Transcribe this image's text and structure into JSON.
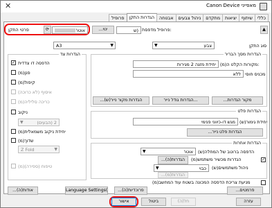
{
  "window": {
    "title": "Canon Device מאפייני",
    "close_glyph": "✕"
  },
  "tabs": [
    "כללי",
    "שיתוף",
    "יציאות",
    "מתקדם",
    "ניהול צבעים",
    "אבטחה",
    "הגדרות התקן",
    "פרופיל"
  ],
  "active_tab": "הגדרות התקן",
  "top": {
    "printer_profile_label": "פרופיל מדפסת:",
    "profile_value": "(ש",
    "change_button": "...ינוי",
    "device_info_label": "פרטי התקן",
    "device_info_value": "אוטו'",
    "device_name_blurred": "",
    "paper_source_label": "סוג התקן",
    "paper_source_value": "צבע",
    "paper_size_value": "A3"
  },
  "general_settings": {
    "legend": "הגדרות מסך הבריר",
    "input_label": "מקורות הקלט ה(מ):",
    "input_value": "יחידת מזגה 2 מגירות",
    "output_label": "מכניס חוסי",
    "output_value": "ללא",
    "btn_paper_source": "...מקור הגדרות",
    "btn_tray": "הגדרות גודל נייר...",
    "btn_settings": "...(ש)הגדרות מקור נייר"
  },
  "paper_settings": {
    "legend": "הגדרות פלט",
    "output_unit_label": "יחידת גימור(ש)",
    "output_unit_value": "מגש דו-כיווני פנימי",
    "btn_output": "...הגדרות פלט נייר"
  },
  "other_settings": {
    "legend": "הגדרות אחרות",
    "auto_label": "(ש)הדפסה ברוטב של המחלה",
    "auto_value": "אוטו'",
    "user_settings_label": "(מ)הגדרות מכשיר משתמש",
    "btn_user": "...(ה)הגדרות",
    "management_label": "(ש)ניהול משתמשים",
    "management_value": "כבוי",
    "btn_management": "...(מ)הגדרות",
    "duplex_label": "(מ)מניעת צריכת הדפסה המכונה בשטח עוד המחשב"
  },
  "options": {
    "legend": "הגדרות צד",
    "items": [
      {
        "label": "הדפסה דו צדדית",
        "checked": true,
        "disabled": false
      },
      {
        "label": "(מ)פנן",
        "checked": false,
        "disabled": false
      },
      {
        "label": "(מ)קיפול",
        "checked": false,
        "disabled": false
      },
      {
        "label": "איסוף (לא כרוכה)",
        "checked": false,
        "disabled": true
      },
      {
        "label": "(מ)כריכה סליליה",
        "checked": false,
        "disabled": true
      },
      {
        "label": "ניקוב",
        "checked": false,
        "disabled": false
      }
    ],
    "punch_select": "2 (הבעים)",
    "fold_unit_label": "(מ)יחידת ניקוב משמאלית",
    "staple_label": "(מ)שדוך",
    "staple_select": "Z Fold",
    "staple_disabled_label": "(מ)טיפוח (ספירה)",
    "staple_disabled_select": ""
  },
  "bottom_buttons": {
    "about": "...(ה)אודות",
    "language": "Language Settings(ר)...",
    "preferences": "...(ה)פרוכדיות",
    "profiles": "...פרמטים"
  },
  "footer": {
    "ok": "אישור",
    "cancel": "ביטול",
    "apply": "(ה)חל",
    "help": "עזרה"
  },
  "icons": {
    "refresh": "refresh-icon",
    "app": "printer-icon",
    "apply_profile": "apply-icon"
  },
  "accent_color": "#0078d7",
  "highlight_color": "#e11111"
}
